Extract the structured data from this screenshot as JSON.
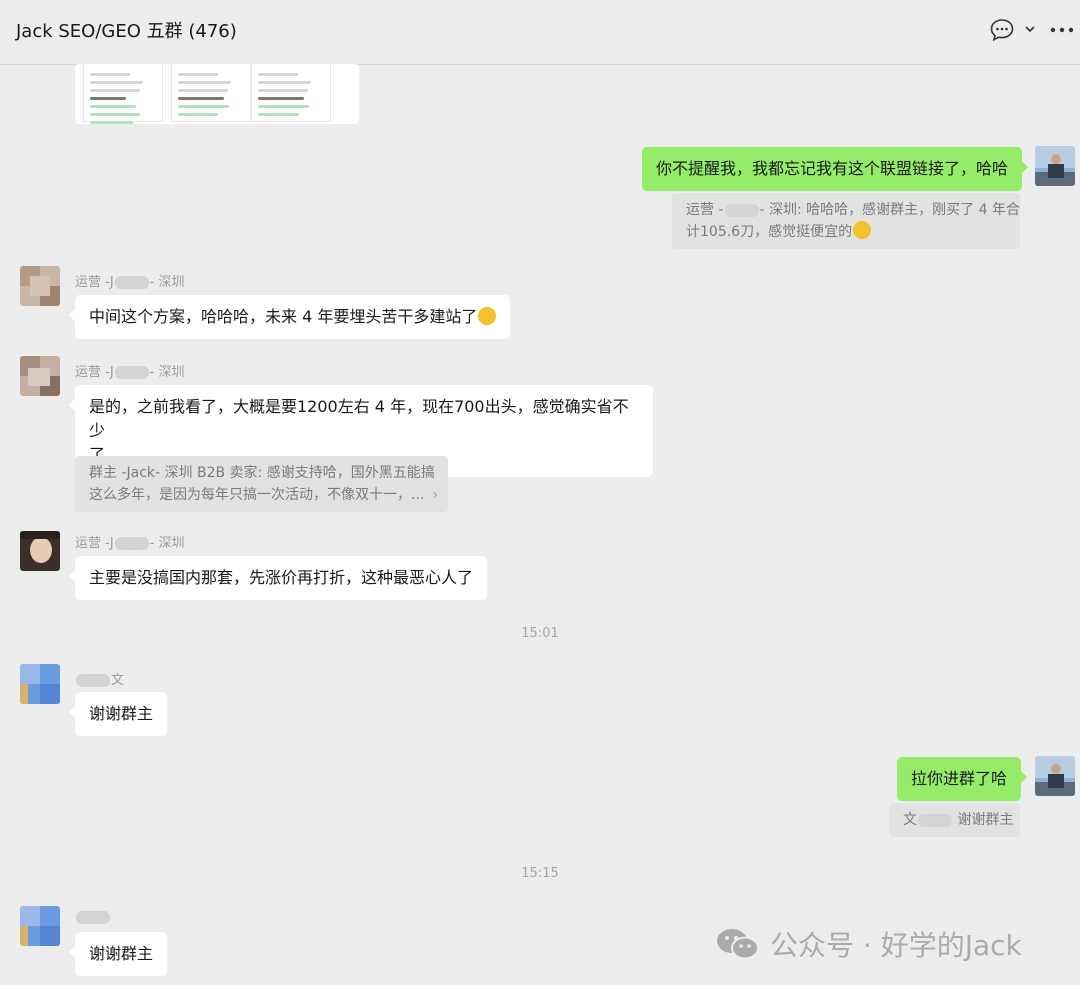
{
  "header": {
    "title": "Jack SEO/GEO 五群 (476)",
    "chat_icon": "chat-bubble-icon",
    "more_icon": "more-dots-icon"
  },
  "messages": [
    {
      "id": "m1",
      "type": "image",
      "direction": "incoming",
      "image": "pricing-plans-screenshot"
    },
    {
      "id": "m2",
      "direction": "outgoing",
      "text": "你不提醒我，我都忘记我有这个联盟链接了，哈哈",
      "quote": {
        "line1_prefix": "运营 -",
        "line1_suffix": "- 深圳: 哈哈哈，感谢群主，刚买了 4 年合",
        "line2": "计105.6刀，感觉挺便宜的"
      }
    },
    {
      "id": "m3",
      "direction": "incoming",
      "sender_prefix": "运营 -J",
      "sender_suffix": "- 深圳",
      "text": "中间这个方案，哈哈哈，未来 4 年要埋头苦干多建站了"
    },
    {
      "id": "m4",
      "direction": "incoming",
      "sender_prefix": "运营 -J",
      "sender_suffix": "- 深圳",
      "text_line1": "是的，之前我看了，大概是要1200左右 4 年，现在700出头，感觉确实省不少",
      "text_line2": "了",
      "quote": {
        "line1": "群主 -Jack- 深圳 B2B 卖家: 感谢支持哈，国外黑五能搞",
        "line2": "这么多年，是因为每年只搞一次活动，不像双十一，..."
      }
    },
    {
      "id": "m5",
      "direction": "incoming",
      "sender_prefix": "运营 -J",
      "sender_suffix": "- 深圳",
      "text": "主要是没搞国内那套，先涨价再打折，这种最恶心人了"
    },
    {
      "id": "t1",
      "type": "time",
      "text": "15:01"
    },
    {
      "id": "m6",
      "direction": "incoming",
      "sender_suffix": "文",
      "text": "谢谢群主"
    },
    {
      "id": "m7",
      "direction": "outgoing",
      "text": "拉你进群了哈",
      "quote": {
        "prefix": "文",
        "suffix": "谢谢群主"
      }
    },
    {
      "id": "t2",
      "type": "time",
      "text": "15:15"
    },
    {
      "id": "m8",
      "direction": "incoming",
      "text": "谢谢群主"
    }
  ],
  "watermark": {
    "text": "公众号 · 好学的Jack",
    "icon": "wechat-icon"
  },
  "colors": {
    "background": "#ededed",
    "outgoing_bubble": "#95ec69",
    "incoming_bubble": "#ffffff"
  }
}
